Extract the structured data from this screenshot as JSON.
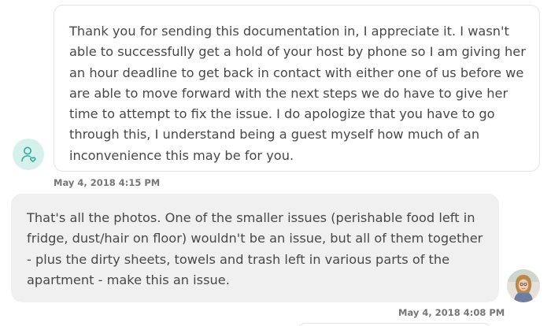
{
  "conversation": {
    "incoming": {
      "avatar_icon": "support-agent-icon",
      "avatar_color": "#d6f1ec",
      "icon_color": "#38a89b",
      "text": "Thank you for sending this documentation in, I appreciate it. I wasn't able to successfully get a hold of your host by phone so I am giving her an hour deadline to get back in contact with either one of us before we are able to move forward with the next steps we do have to give her time to attempt to fix the issue. I do apologize that you have to go through this, I understand being a guest myself how much of an inconvenience this may be for you.",
      "timestamp": "May 4, 2018 4:15 PM"
    },
    "outgoing": {
      "text": "That's all the photos. One of the smaller issues (perishable food left in fridge, dust/hair on floor) wouldn't be an issue, but all of them together - plus the dirty sheets, towels and trash left in various parts of the apartment - make this an issue.",
      "timestamp": "May 4, 2018 4:08 PM",
      "bubble_color": "#f0f0f0"
    }
  }
}
